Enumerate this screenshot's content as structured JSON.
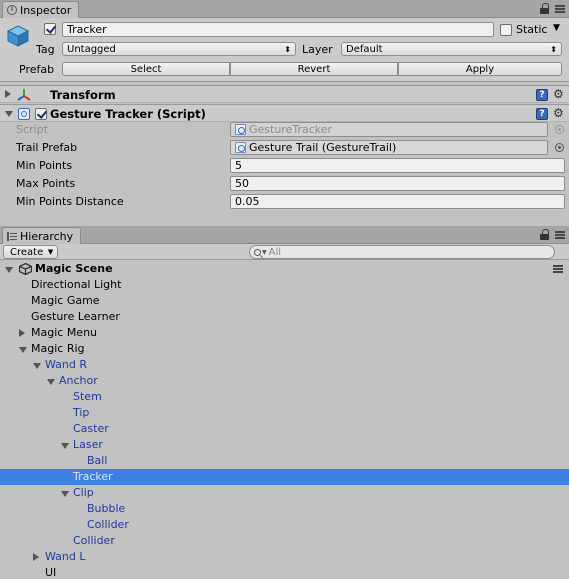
{
  "inspector": {
    "tab_title": "Inspector",
    "object_name": "Tracker",
    "static_label": "Static",
    "tag_label": "Tag",
    "tag_value": "Untagged",
    "layer_label": "Layer",
    "layer_value": "Default",
    "prefab_label": "Prefab",
    "prefab_buttons": {
      "select": "Select",
      "revert": "Revert",
      "apply": "Apply"
    },
    "transform": {
      "title": "Transform"
    },
    "gesture_tracker": {
      "title": "Gesture Tracker (Script)",
      "props": {
        "script": {
          "label": "Script",
          "value": "GestureTracker"
        },
        "trail_prefab": {
          "label": "Trail Prefab",
          "value": "Gesture Trail (GestureTrail)"
        },
        "min_points": {
          "label": "Min Points",
          "value": "5"
        },
        "max_points": {
          "label": "Max Points",
          "value": "50"
        },
        "min_points_distance": {
          "label": "Min Points Distance",
          "value": "0.05"
        }
      }
    },
    "help_glyph": "?",
    "gear_glyph": "⚙"
  },
  "hierarchy": {
    "tab_title": "Hierarchy",
    "create_label": "Create",
    "search_placeholder": "All",
    "scene_name": "Magic Scene",
    "items": [
      {
        "label": "Directional Light",
        "depth": 1,
        "expander": "none",
        "prefab": false,
        "selected": false
      },
      {
        "label": "Magic Game",
        "depth": 1,
        "expander": "none",
        "prefab": false,
        "selected": false
      },
      {
        "label": "Gesture Learner",
        "depth": 1,
        "expander": "none",
        "prefab": false,
        "selected": false
      },
      {
        "label": "Magic Menu",
        "depth": 1,
        "expander": "collapsed",
        "prefab": false,
        "selected": false
      },
      {
        "label": "Magic Rig",
        "depth": 1,
        "expander": "expanded",
        "prefab": false,
        "selected": false
      },
      {
        "label": "Wand R",
        "depth": 2,
        "expander": "expanded",
        "prefab": true,
        "selected": false
      },
      {
        "label": "Anchor",
        "depth": 3,
        "expander": "expanded",
        "prefab": true,
        "selected": false
      },
      {
        "label": "Stem",
        "depth": 4,
        "expander": "none",
        "prefab": true,
        "selected": false
      },
      {
        "label": "Tip",
        "depth": 4,
        "expander": "none",
        "prefab": true,
        "selected": false
      },
      {
        "label": "Caster",
        "depth": 4,
        "expander": "none",
        "prefab": true,
        "selected": false
      },
      {
        "label": "Laser",
        "depth": 4,
        "expander": "expanded",
        "prefab": true,
        "selected": false
      },
      {
        "label": "Ball",
        "depth": 5,
        "expander": "none",
        "prefab": true,
        "selected": false
      },
      {
        "label": "Tracker",
        "depth": 4,
        "expander": "none",
        "prefab": true,
        "selected": true
      },
      {
        "label": "Clip",
        "depth": 4,
        "expander": "expanded",
        "prefab": true,
        "selected": false
      },
      {
        "label": "Bubble",
        "depth": 5,
        "expander": "none",
        "prefab": true,
        "selected": false
      },
      {
        "label": "Collider",
        "depth": 5,
        "expander": "none",
        "prefab": true,
        "selected": false
      },
      {
        "label": "Collider",
        "depth": 4,
        "expander": "none",
        "prefab": true,
        "selected": false
      },
      {
        "label": "Wand L",
        "depth": 2,
        "expander": "collapsed",
        "prefab": true,
        "selected": false
      },
      {
        "label": "UI",
        "depth": 2,
        "expander": "none",
        "prefab": false,
        "selected": false
      }
    ]
  },
  "colors": {
    "panel_bg": "#c2c2c2",
    "selection": "#3d80df",
    "prefab_text": "#1a3aa0"
  }
}
